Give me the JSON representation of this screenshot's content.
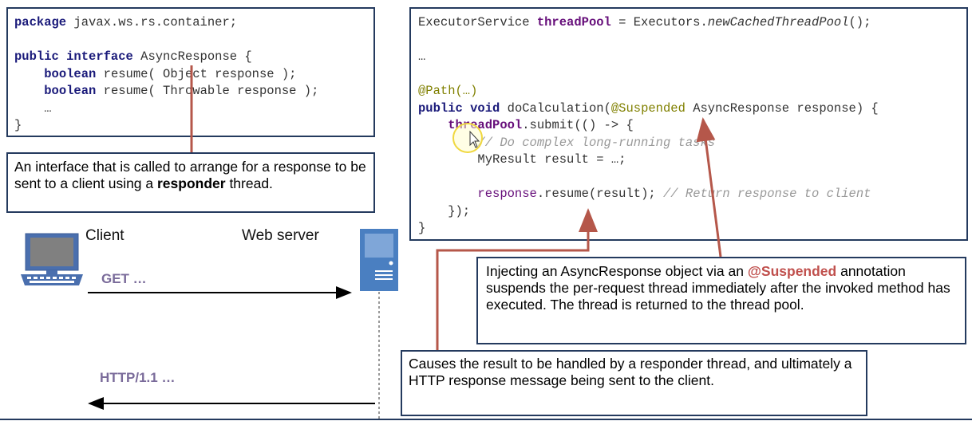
{
  "interface_code": {
    "line1_kw": "package",
    "line1_rest": " javax.ws.rs.container;",
    "line2_kw1": "public",
    "line2_kw2": "interface",
    "line2_rest": " AsyncResponse {",
    "line3_kw": "boolean",
    "line3_rest": " resume( Object response );",
    "line4_kw": "boolean",
    "line4_rest": " resume( Throwable response );",
    "line5": "    …",
    "line6": "}"
  },
  "impl_code": {
    "l1_type": "ExecutorService ",
    "l1_field": "threadPool",
    "l1_mid": " = Executors.",
    "l1_method": "newCachedThreadPool",
    "l1_end": "();",
    "l2": "…",
    "l3_ann": "@Path(…)",
    "l4_kw1": "public",
    "l4_kw2": "void",
    "l4_name": " doCalculation(",
    "l4_ann": "@Suspended",
    "l4_rest": " AsyncResponse response) {",
    "l5_field": "threadPool",
    "l5_rest": ".submit(() -> {",
    "l6_comment": "// Do complex long-running tasks",
    "l7": "MyResult result = …;",
    "l8_field": "response",
    "l8_rest": ".resume(result); ",
    "l8_comment": "// Return response to client",
    "l9": "    });",
    "l10": "}"
  },
  "notes": {
    "interface_note_1": "An interface that is called to arrange for a response to be sent to a client using a ",
    "interface_note_bold": "responder",
    "interface_note_2": " thread.",
    "suspended_note_1": "Injecting an AsyncResponse object via an ",
    "suspended_note_highlight": "@Suspended",
    "suspended_note_2": " annotation suspends the per-request thread immediately after the invoked method has executed. The thread is returned to the thread pool.",
    "resume_note": "Causes the result to be handled by a responder thread, and ultimately a HTTP response message being sent to the client."
  },
  "sequence": {
    "client_label": "Client",
    "server_label": "Web server",
    "request_label": "GET …",
    "response_label": "HTTP/1.1 …"
  },
  "colors": {
    "box_border": "#243a5e",
    "pointer_line": "#b5574a",
    "keyword": "#1a1a7a",
    "field": "#660e7a",
    "annotation": "#808000",
    "suspended_highlight": "#c0504d",
    "message_label": "#7a6b9a",
    "server_fill": "#4a7fc1"
  }
}
